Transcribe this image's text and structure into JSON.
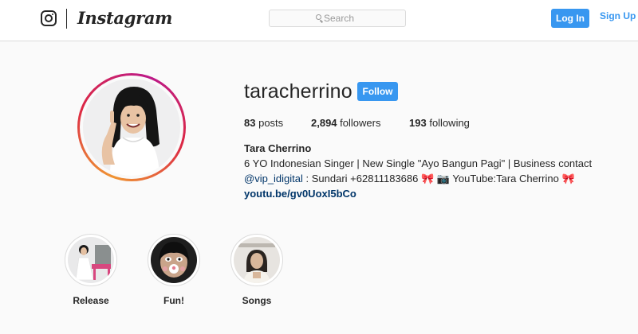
{
  "header": {
    "brand": "Instagram",
    "search_placeholder": "Search",
    "login_label": "Log In",
    "signup_label": "Sign Up"
  },
  "profile": {
    "username": "taracherrino",
    "follow_label": "Follow",
    "stats": {
      "posts_count": "83",
      "posts_label": "posts",
      "followers_count": "2,894",
      "followers_label": "followers",
      "following_count": "193",
      "following_label": "following"
    },
    "full_name": "Tara Cherrino",
    "bio_line1": "6 YO Indonesian Singer | New Single \"Ayo Bangun Pagi\" | Business contact",
    "bio_mention": "@vip_idigital",
    "bio_line2_rest": ": Sundari +62811183686",
    "bio_ribbon": "🎀",
    "bio_camera": "📷",
    "bio_youtube": "YouTube:Tara Cherrino",
    "website": "youtu.be/gv0UoxI5bCo"
  },
  "highlights": [
    {
      "label": "Release"
    },
    {
      "label": "Fun!"
    },
    {
      "label": "Songs"
    }
  ],
  "icons": {
    "logo": "instagram-glyph-icon",
    "search": "search-icon"
  },
  "colors": {
    "accent": "#3897f0",
    "link": "#003569",
    "text": "#262626",
    "background": "#fafafa"
  }
}
